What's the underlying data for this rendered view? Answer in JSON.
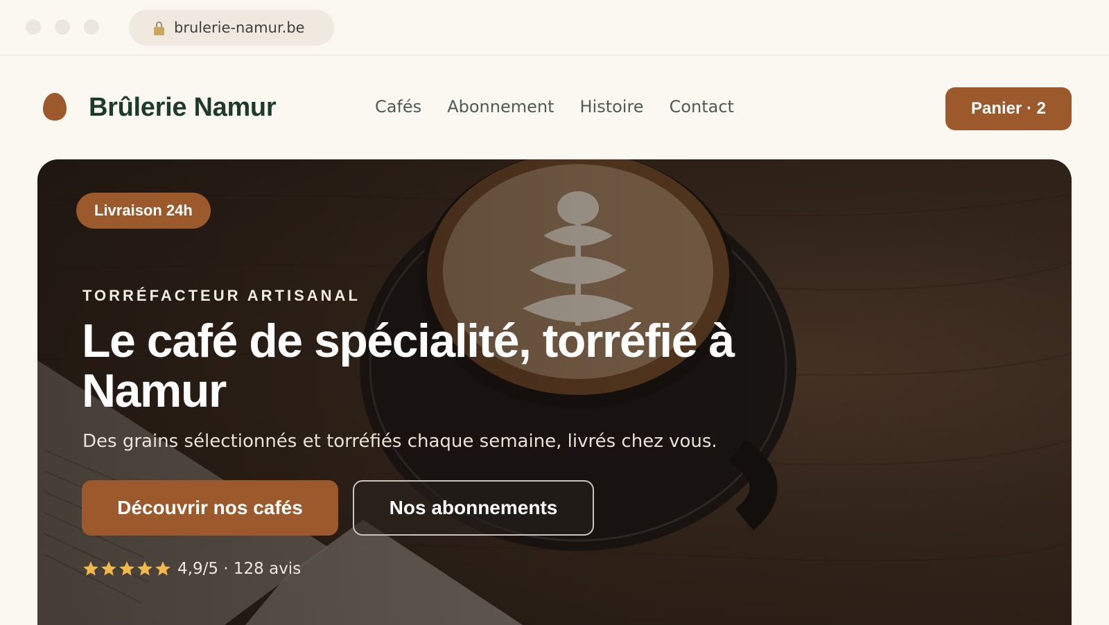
{
  "browser": {
    "url": "brulerie-namur.be",
    "lock_icon": "lock-icon"
  },
  "header": {
    "brand": "Brûlerie Namur",
    "nav": [
      {
        "label": "Cafés"
      },
      {
        "label": "Abonnement"
      },
      {
        "label": "Histoire"
      },
      {
        "label": "Contact"
      }
    ],
    "cart_label": "Panier · 2"
  },
  "hero": {
    "badge": "Livraison 24h",
    "eyebrow": "TORRÉFACTEUR ARTISANAL",
    "title": "Le café de spécialité, torréfié à Namur",
    "subtitle": "Des grains sélectionnés et torréfiés chaque semaine, livrés chez vous.",
    "primary_cta": "Découvrir nos cafés",
    "secondary_cta": "Nos abonnements",
    "rating": {
      "stars": 5,
      "text": "4,9/5 · 128 avis"
    }
  },
  "colors": {
    "accent": "#9c5a2c",
    "brand_text": "#1e3a2c",
    "star": "#f2b84b",
    "page_bg": "#fbf8f1"
  }
}
